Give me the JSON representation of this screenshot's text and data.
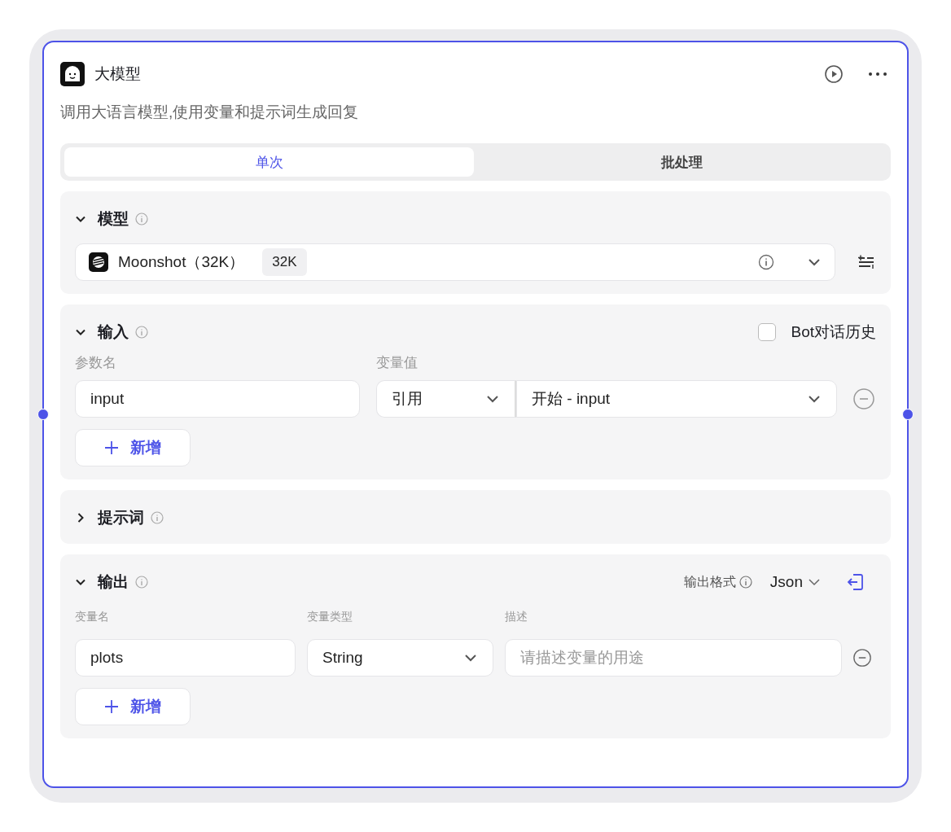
{
  "node": {
    "title": "大模型",
    "description": "调用大语言模型,使用变量和提示词生成回复"
  },
  "tabs": [
    {
      "label": "单次",
      "selected": true
    },
    {
      "label": "批处理",
      "selected": false
    }
  ],
  "model_section": {
    "title": "模型",
    "expanded": true,
    "model_name": "Moonshot（32K）",
    "badge": "32K"
  },
  "input_section": {
    "title": "输入",
    "expanded": true,
    "bot_history": {
      "label": "Bot对话历史",
      "checked": false
    },
    "columns": [
      "参数名",
      "变量值"
    ],
    "rows": [
      {
        "name": "input",
        "source_type": "引用",
        "value": "开始 - input"
      }
    ],
    "add_button": "新增"
  },
  "prompt_section": {
    "title": "提示词",
    "expanded": false
  },
  "output_section": {
    "title": "输出",
    "expanded": true,
    "format_label": "输出格式",
    "format": "Json",
    "columns": [
      "变量名",
      "变量类型",
      "描述"
    ],
    "rows": [
      {
        "name": "plots",
        "type": "String",
        "description_placeholder": "请描述变量的用途"
      }
    ],
    "add_button": "新增"
  }
}
